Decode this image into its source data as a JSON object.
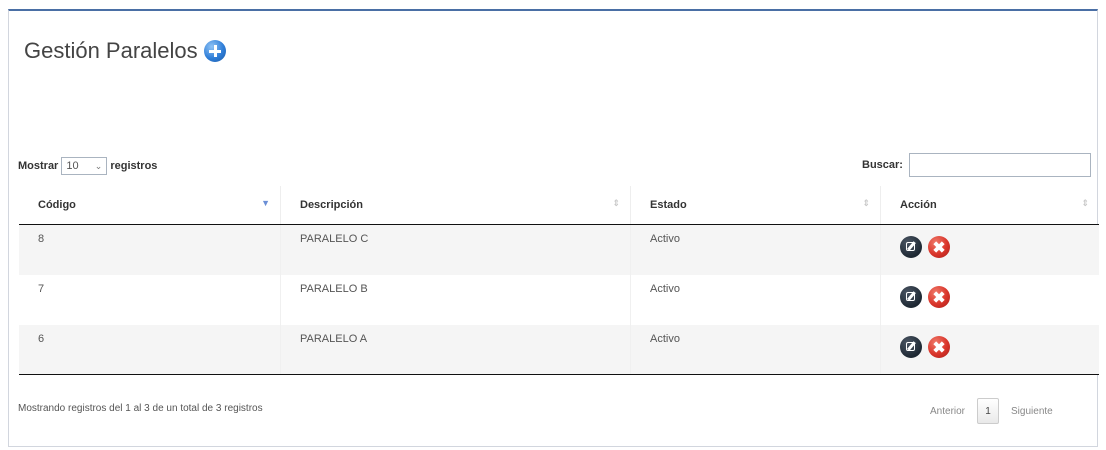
{
  "header": {
    "title": "Gestión Paralelos",
    "add_icon": "add-circle-icon",
    "accent_color": "#2f7ed8"
  },
  "controls": {
    "show_label": "Mostrar",
    "page_length": "10",
    "records_label": "registros",
    "search_label": "Buscar:",
    "search_value": ""
  },
  "table": {
    "columns": [
      "Código",
      "Descripción",
      "Estado",
      "Acción"
    ],
    "sorted_column": "Código",
    "rows": [
      {
        "codigo": "8",
        "descripcion": "PARALELO C",
        "estado": "Activo"
      },
      {
        "codigo": "7",
        "descripcion": "PARALELO B",
        "estado": "Activo"
      },
      {
        "codigo": "6",
        "descripcion": "PARALELO A",
        "estado": "Activo"
      }
    ],
    "row_actions": [
      "edit-icon",
      "delete-icon"
    ]
  },
  "footer": {
    "info": "Mostrando registros del 1 al 3 de un total de 3 registros",
    "prev_label": "Anterior",
    "page": "1",
    "next_label": "Siguiente"
  }
}
